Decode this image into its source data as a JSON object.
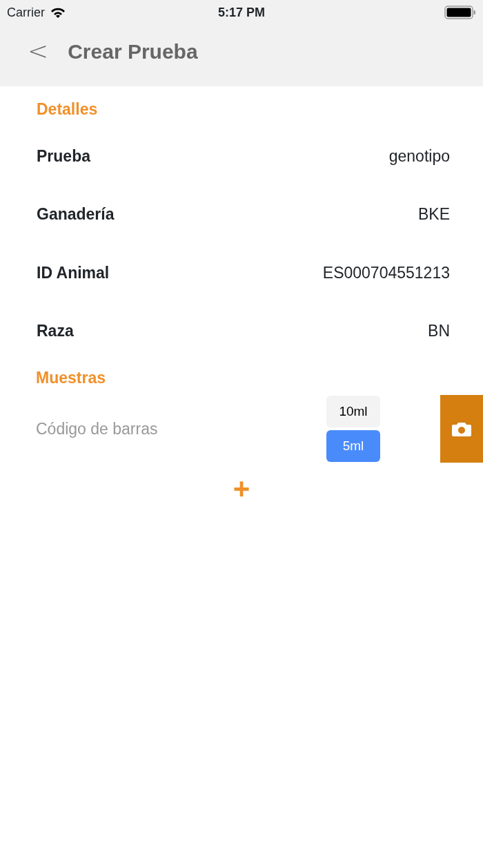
{
  "status_bar": {
    "carrier": "Carrier",
    "time": "5:17 PM"
  },
  "nav": {
    "back": "<",
    "title": "Crear Prueba"
  },
  "details": {
    "heading": "Detalles",
    "rows": [
      {
        "label": "Prueba",
        "value": "genotipo"
      },
      {
        "label": "Ganadería",
        "value": "BKE"
      },
      {
        "label": "ID Animal",
        "value": "ES000704551213"
      },
      {
        "label": "Raza",
        "value": "BN"
      }
    ]
  },
  "samples": {
    "heading": "Muestras",
    "items": [
      {
        "barcode": {
          "placeholder": "Código de barras"
        },
        "volumes": [
          {
            "label": "10ml",
            "selected": false
          },
          {
            "label": "5ml",
            "selected": true
          }
        ]
      }
    ],
    "add": "+"
  }
}
